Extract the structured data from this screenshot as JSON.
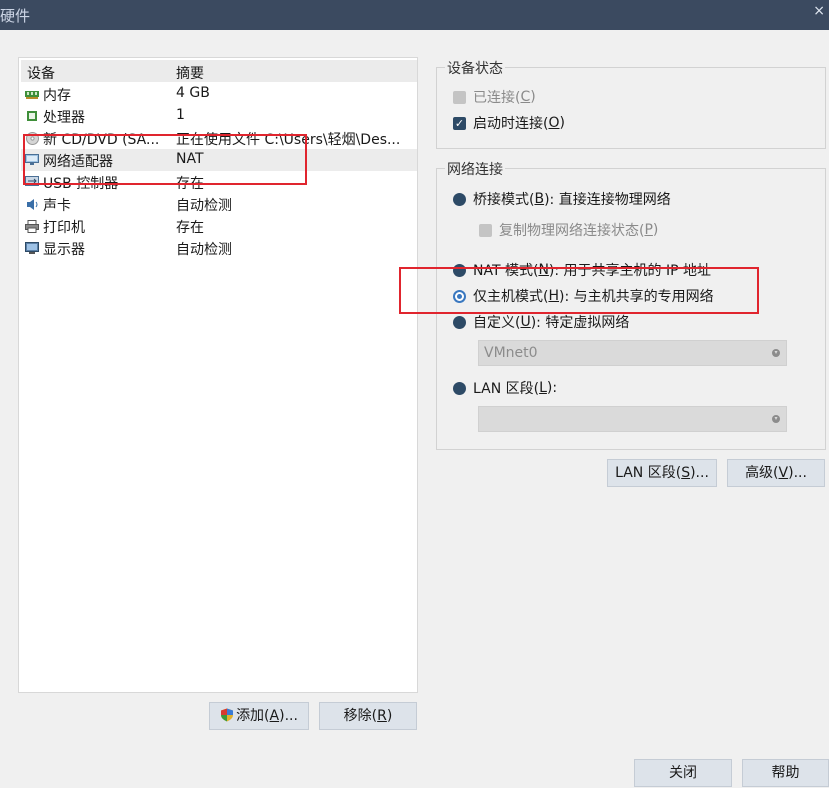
{
  "window": {
    "title": "硬件"
  },
  "device_list": {
    "headers": {
      "device": "设备",
      "summary": "摘要"
    },
    "rows": [
      {
        "name": "内存",
        "summary": "4 GB",
        "icon": "memory-icon"
      },
      {
        "name": "处理器",
        "summary": "1",
        "icon": "processor-icon"
      },
      {
        "name": "新 CD/DVD (SA...",
        "summary": "正在使用文件 C:\\Users\\轻烟\\Des...",
        "icon": "cd-dvd-icon"
      },
      {
        "name": "网络适配器",
        "summary": "NAT",
        "icon": "network-adapter-icon"
      },
      {
        "name": "USB 控制器",
        "summary": "存在",
        "icon": "usb-icon"
      },
      {
        "name": "声卡",
        "summary": "自动检测",
        "icon": "sound-card-icon"
      },
      {
        "name": "打印机",
        "summary": "存在",
        "icon": "printer-icon"
      },
      {
        "name": "显示器",
        "summary": "自动检测",
        "icon": "display-icon"
      }
    ]
  },
  "buttons": {
    "add": {
      "label": "添加(",
      "mnemonic": "A",
      "suffix": ")..."
    },
    "remove": {
      "label": "移除(",
      "mnemonic": "R",
      "suffix": ")"
    },
    "lan_segments": {
      "label": "LAN 区段(",
      "mnemonic": "S",
      "suffix": ")..."
    },
    "advanced": {
      "label": "高级(",
      "mnemonic": "V",
      "suffix": ")..."
    },
    "close": "关闭",
    "help": "帮助"
  },
  "device_status": {
    "title": "设备状态",
    "connected": {
      "label": "已连接(",
      "mnemonic": "C",
      "suffix": ")",
      "checked": false,
      "enabled": false
    },
    "connect_at_power_on": {
      "label": "启动时连接(",
      "mnemonic": "O",
      "suffix": ")",
      "checked": true
    }
  },
  "network_connection": {
    "title": "网络连接",
    "bridged": {
      "label": "桥接模式(",
      "mnemonic": "B",
      "suffix": "): 直接连接物理网络"
    },
    "replicate": {
      "label": "复制物理网络连接状态(",
      "mnemonic": "P",
      "suffix": ")",
      "enabled": false
    },
    "nat": {
      "label": "NAT 模式(",
      "mnemonic": "N",
      "suffix": "): 用于共享主机的 IP 地址"
    },
    "host_only": {
      "label": "仅主机模式(",
      "mnemonic": "H",
      "suffix": "): 与主机共享的专用网络",
      "selected": true
    },
    "custom": {
      "label": "自定义(",
      "mnemonic": "U",
      "suffix": "): 特定虚拟网络"
    },
    "custom_select": {
      "value": "VMnet0"
    },
    "lan_segment": {
      "label": "LAN 区段(",
      "mnemonic": "L",
      "suffix": "):"
    },
    "lan_select": {
      "value": ""
    }
  },
  "colors": {
    "accent": "#2d4a66",
    "selection_ring": "#3a78c0",
    "annotation_red": "#e0252e"
  }
}
